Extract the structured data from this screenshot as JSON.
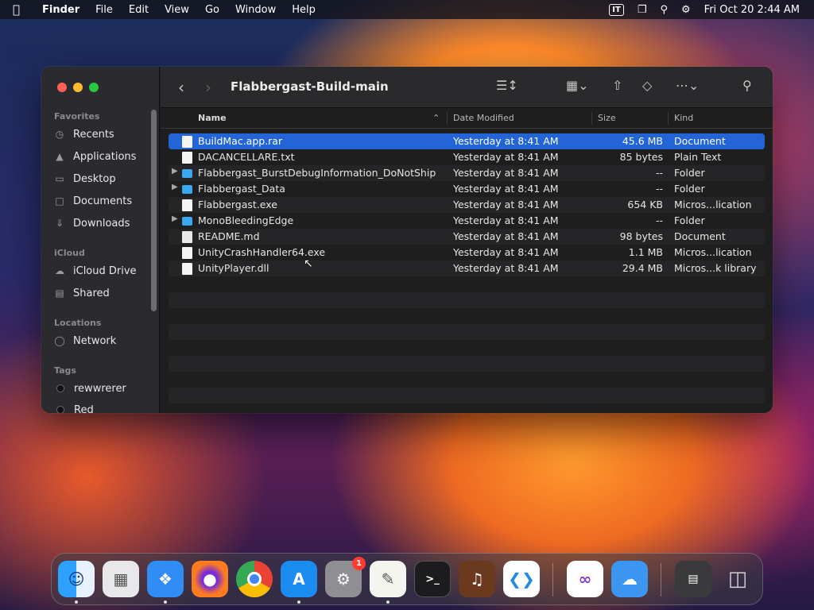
{
  "menubar": {
    "app_name": "Finder",
    "menus": [
      "File",
      "Edit",
      "View",
      "Go",
      "Window",
      "Help"
    ],
    "input_source": "IT",
    "clock": "Fri Oct 20  2:44 AM"
  },
  "window": {
    "title": "Flabbergast-Build-main"
  },
  "sidebar": {
    "favorites_heading": "Favorites",
    "favorites": [
      "Recents",
      "Applications",
      "Desktop",
      "Documents",
      "Downloads"
    ],
    "icloud_heading": "iCloud",
    "icloud": [
      "iCloud Drive",
      "Shared"
    ],
    "locations_heading": "Locations",
    "locations": [
      "Network"
    ],
    "tags_heading": "Tags",
    "tags": [
      "rewwrerer",
      "Red"
    ]
  },
  "columns": {
    "name": "Name",
    "date": "Date Modified",
    "size": "Size",
    "kind": "Kind"
  },
  "files": [
    {
      "name": "BuildMac.app.rar",
      "date": "Yesterday at 8:41 AM",
      "size": "45.6 MB",
      "kind": "Document"
    },
    {
      "name": "DACANCELLARE.txt",
      "date": "Yesterday at 8:41 AM",
      "size": "85 bytes",
      "kind": "Plain Text"
    },
    {
      "name": "Flabbergast_BurstDebugInformation_DoNotShip",
      "date": "Yesterday at 8:41 AM",
      "size": "--",
      "kind": "Folder"
    },
    {
      "name": "Flabbergast_Data",
      "date": "Yesterday at 8:41 AM",
      "size": "--",
      "kind": "Folder"
    },
    {
      "name": "Flabbergast.exe",
      "date": "Yesterday at 8:41 AM",
      "size": "654 KB",
      "kind": "Micros...lication"
    },
    {
      "name": "MonoBleedingEdge",
      "date": "Yesterday at 8:41 AM",
      "size": "--",
      "kind": "Folder"
    },
    {
      "name": "README.md",
      "date": "Yesterday at 8:41 AM",
      "size": "98 bytes",
      "kind": "Document"
    },
    {
      "name": "UnityCrashHandler64.exe",
      "date": "Yesterday at 8:41 AM",
      "size": "1.1 MB",
      "kind": "Micros...lication"
    },
    {
      "name": "UnityPlayer.dll",
      "date": "Yesterday at 8:41 AM",
      "size": "29.4 MB",
      "kind": "Micros...k library"
    }
  ],
  "dock": {
    "settings_badge": "1"
  }
}
